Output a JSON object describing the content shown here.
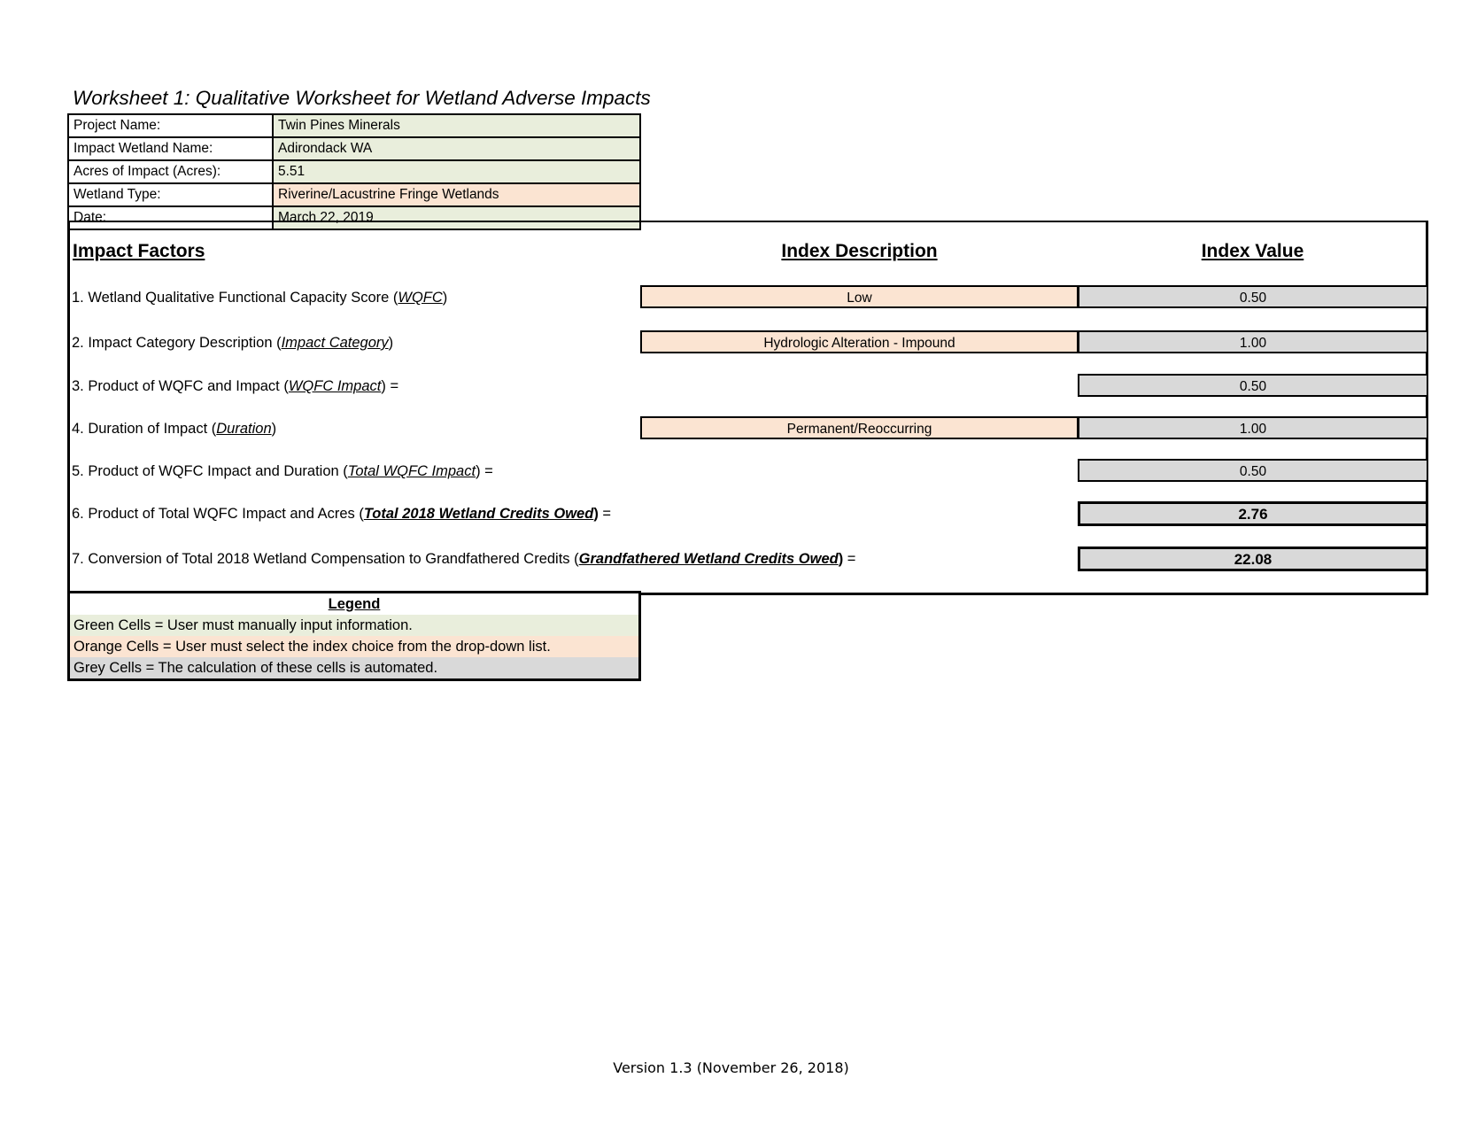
{
  "title": "Worksheet 1:  Qualitative Worksheet for Wetland Adverse Impacts",
  "project_info": {
    "rows": [
      {
        "label": "Project Name:",
        "value": "Twin Pines Minerals",
        "fill": "green"
      },
      {
        "label": "Impact Wetland Name:",
        "value": "Adirondack WA",
        "fill": "green"
      },
      {
        "label": "Acres of Impact (Acres):",
        "value": "5.51",
        "fill": "green"
      },
      {
        "label": "Wetland Type:",
        "value": "Riverine/Lacustrine Fringe Wetlands",
        "fill": "orange"
      },
      {
        "label": "Date:",
        "value": "March 22, 2019",
        "fill": "green"
      }
    ]
  },
  "columns": {
    "impact_factors": "Impact Factors",
    "index_description": "Index Description",
    "index_value": "Index Value"
  },
  "factors": [
    {
      "number": "1.",
      "text_plain": "1. Wetland Qualitative Functional Capacity Score (WQFC)",
      "lead": "1. Wetland Qualitative Functional Capacity Score (",
      "term": "WQFC",
      "tail": ")",
      "description": "Low",
      "value": "0.50",
      "has_description": true
    },
    {
      "number": "2.",
      "text_plain": "2. Impact Category Description (Impact Category)",
      "lead": "2. Impact Category Description (",
      "term": "Impact Category",
      "tail": ")",
      "description": "Hydrologic Alteration - Impound",
      "value": "1.00",
      "has_description": true
    },
    {
      "number": "3.",
      "text_plain": "3. Product of WQFC and Impact (WQFC Impact) =",
      "lead": "3. Product of WQFC and Impact (",
      "term": "WQFC Impact",
      "tail": ") =",
      "description": "",
      "value": "0.50",
      "has_description": false
    },
    {
      "number": "4.",
      "text_plain": "4. Duration of Impact (Duration)",
      "lead": "4. Duration of Impact (",
      "term": "Duration",
      "tail": ")",
      "description": "Permanent/Reoccurring",
      "value": "1.00",
      "has_description": true
    },
    {
      "number": "5.",
      "text_plain": "5. Product of WQFC Impact and Duration (Total WQFC Impact) =",
      "lead": "5. Product of WQFC Impact and Duration (",
      "term": "Total WQFC Impact",
      "tail": ") =",
      "description": "",
      "value": "0.50",
      "has_description": false
    },
    {
      "number": "6.",
      "text_plain": "6. Product of Total WQFC Impact and Acres (Total 2018 Wetland Credits Owed) =",
      "lead": "6. Product of Total WQFC Impact and Acres (",
      "term": "Total 2018 Wetland Credits Owed",
      "tail": ") =",
      "description": "",
      "value": "2.76",
      "has_description": false,
      "bold_term": true,
      "bold_value": true
    },
    {
      "number": "7.",
      "text_plain": "7. Conversion of Total 2018 Wetland Compensation to Grandfathered Credits (Grandfathered Wetland Credits Owed) =",
      "lead": "7. Conversion of Total 2018 Wetland Compensation to Grandfathered Credits (",
      "term": "Grandfathered Wetland Credits Owed",
      "tail": ") =",
      "description": "",
      "value": "22.08",
      "has_description": false,
      "bold_term": true,
      "bold_value": true
    }
  ],
  "legend": {
    "title": "Legend",
    "rows": [
      {
        "text": "Green Cells = User must manually input information.",
        "fill": "green"
      },
      {
        "text": "Orange Cells = User must select the index choice from the drop-down list.",
        "fill": "orange"
      },
      {
        "text": "Grey Cells = The calculation of these cells is automated.",
        "fill": "grey"
      }
    ]
  },
  "footer": "Version 1.3 (November 26, 2018)",
  "colors": {
    "green": "#e9eedc",
    "orange": "#fbe4d2",
    "grey": "#d9d9d9",
    "border": "#000000"
  }
}
